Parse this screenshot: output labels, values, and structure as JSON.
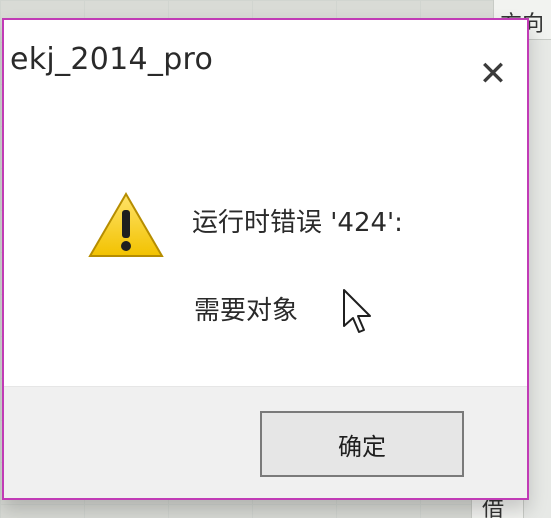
{
  "background": {
    "top_right_cell_text": "方向",
    "bottom_right_cell_text": "借"
  },
  "dialog": {
    "title": "ekj_2014_pro",
    "message_line1": "运行时错误 '424':",
    "message_line2": "需要对象",
    "ok_label": "确定",
    "close_glyph": "✕",
    "border_color": "#c13bb6",
    "warning_color": "#f2c200"
  }
}
